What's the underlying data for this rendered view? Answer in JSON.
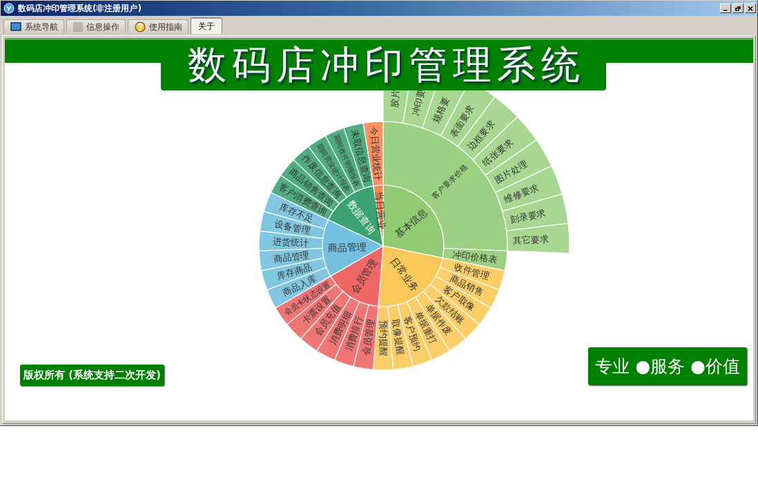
{
  "window": {
    "title": "数码店冲印管理系统(非注册用户)"
  },
  "tabs": [
    {
      "label": "系统导航",
      "selected": false
    },
    {
      "label": "信息操作",
      "selected": false
    },
    {
      "label": "使用指南",
      "selected": false
    },
    {
      "label": "关于",
      "selected": true
    }
  ],
  "banner": {
    "title": "数码店冲印管理系统"
  },
  "sunburst": {
    "nodes": [
      {
        "label": "基本信息",
        "color": "#91cc75",
        "children": [
          {
            "label": "客户要求价格",
            "children": [
              {
                "label": "胶片"
              },
              {
                "label": "冲印要"
              },
              {
                "label": "规格要"
              },
              {
                "label": "表面要求"
              },
              {
                "label": "边框要求"
              },
              {
                "label": "纸张要求"
              },
              {
                "label": "图片处理"
              },
              {
                "label": "维修要求"
              },
              {
                "label": "刻录要求"
              },
              {
                "label": "其它要求"
              }
            ]
          },
          {
            "label": "冲印价格表"
          }
        ]
      },
      {
        "label": "日常业务",
        "color": "#fac858",
        "children": [
          {
            "label": "收件管理"
          },
          {
            "label": "商品销售"
          },
          {
            "label": "客户取像"
          },
          {
            "label": "欠款结账"
          },
          {
            "label": "单据作废"
          },
          {
            "label": "单据重打"
          },
          {
            "label": "客户预约"
          },
          {
            "label": "取像提醒"
          },
          {
            "label": "预约提醒"
          }
        ]
      },
      {
        "label": "会员管理",
        "color": "#ee6666",
        "children": [
          {
            "label": "会员管理"
          },
          {
            "label": "消费排行"
          },
          {
            "label": "消费明细"
          },
          {
            "label": "会员充值"
          },
          {
            "label": "卡票设置"
          },
          {
            "label": "会员卡状态设置"
          }
        ]
      },
      {
        "label": "商品管理",
        "color": "#73c0de",
        "children": [
          {
            "label": "商品入库"
          },
          {
            "label": "库存商品"
          },
          {
            "label": "商品管理"
          },
          {
            "label": "进货统计"
          },
          {
            "label": "设备管理"
          },
          {
            "label": "库存不足"
          }
        ]
      },
      {
        "label": "数据查询",
        "color": "#3ba272",
        "children": [
          {
            "label": "客户消费查询"
          },
          {
            "label": "商品销售查询"
          },
          {
            "label": "作废信息查询"
          },
          {
            "label": "期间营业统计报表"
          },
          {
            "label": "期间收件明细报表"
          },
          {
            "label": "未取信息查询"
          }
        ]
      },
      {
        "label": "当日营业",
        "color": "#fc8452",
        "children": [
          {
            "label": "今日营业统计"
          }
        ]
      }
    ]
  },
  "copyright": "版权所有 (系统支持二次开发)",
  "slogan": "专业 ●服务 ●价值"
}
